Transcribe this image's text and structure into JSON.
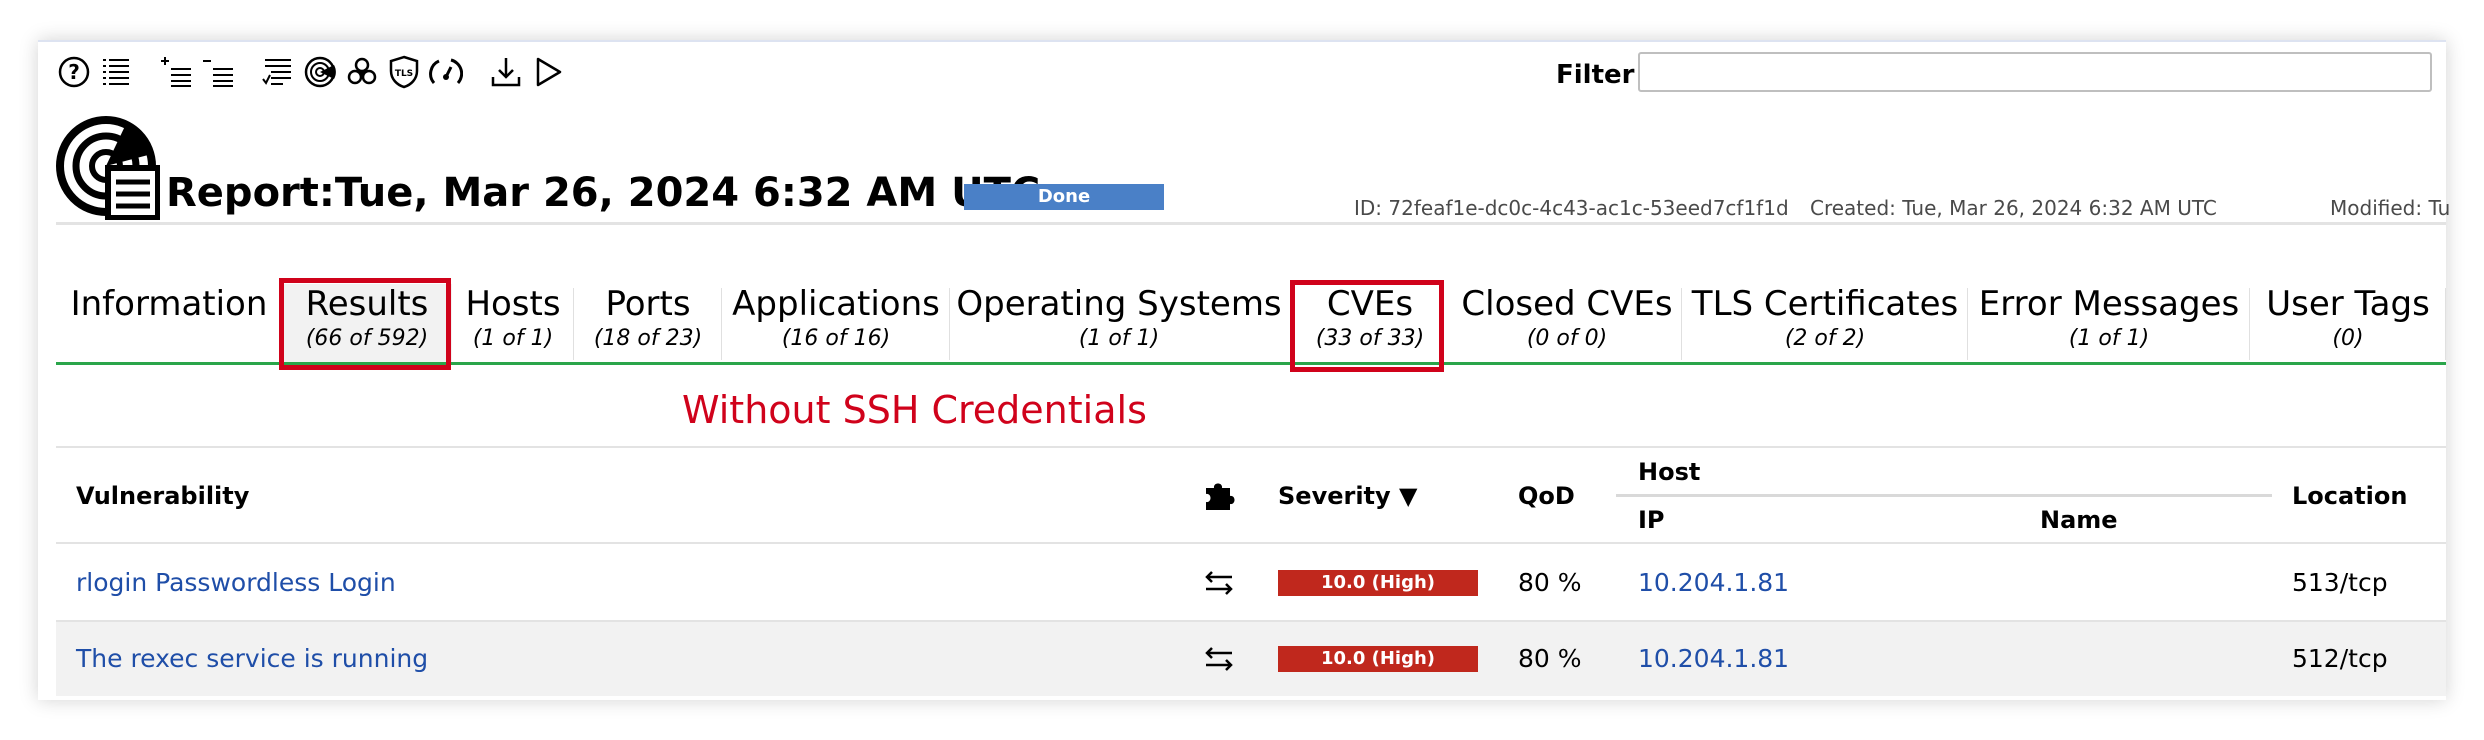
{
  "toolbar": {
    "icons": [
      "help-icon",
      "list-icon",
      "add-list-icon",
      "remove-list-icon",
      "checklist-icon",
      "radar-icon",
      "biohazard-icon",
      "tls-shield-icon",
      "gauge-icon",
      "download-icon",
      "play-icon"
    ]
  },
  "filter": {
    "label": "Filter",
    "value": ""
  },
  "report": {
    "title": "Report:Tue, Mar 26, 2024 6:32 AM UTC",
    "status": "Done",
    "id": "ID: 72feaf1e-dc0c-4c43-ac1c-53eed7cf1f1d",
    "created": "Created: Tue, Mar 26, 2024 6:32 AM UTC",
    "modified": "Modified: Tu"
  },
  "tabs": [
    {
      "label": "Information",
      "count": ""
    },
    {
      "label": "Results",
      "count": "(66 of 592)"
    },
    {
      "label": "Hosts",
      "count": "(1 of 1)"
    },
    {
      "label": "Ports",
      "count": "(18 of 23)"
    },
    {
      "label": "Applications",
      "count": "(16 of 16)"
    },
    {
      "label": "Operating Systems",
      "count": "(1 of 1)"
    },
    {
      "label": "CVEs",
      "count": "(33 of 33)"
    },
    {
      "label": "Closed CVEs",
      "count": "(0 of 0)"
    },
    {
      "label": "TLS Certificates",
      "count": "(2 of 2)"
    },
    {
      "label": "Error Messages",
      "count": "(1 of 1)"
    },
    {
      "label": "User Tags",
      "count": "(0)"
    }
  ],
  "annotation": "Without SSH Credentials",
  "table": {
    "headers": {
      "vulnerability": "Vulnerability",
      "severity": "Severity ▼",
      "qod": "QoD",
      "host": "Host",
      "ip": "IP",
      "name": "Name",
      "location": "Location"
    },
    "rows": [
      {
        "vulnerability": "rlogin Passwordless Login",
        "severity": "10.0 (High)",
        "qod": "80 %",
        "ip": "10.204.1.81",
        "name": "",
        "location": "513/tcp"
      },
      {
        "vulnerability": "The rexec service is running",
        "severity": "10.0 (High)",
        "qod": "80 %",
        "ip": "10.204.1.81",
        "name": "",
        "location": "512/tcp"
      }
    ]
  },
  "colors": {
    "accent_green": "#2aa54a",
    "highlight_red": "#d0021b",
    "severity_high": "#c0281d",
    "status_blue": "#4a80c7",
    "link_blue": "#1f4ea8"
  }
}
